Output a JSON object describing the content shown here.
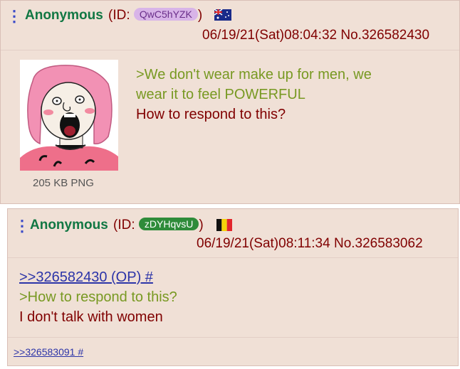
{
  "posts": [
    {
      "name": "Anonymous",
      "id_prefix": "(ID:",
      "id": "QwC5hYZK",
      "id_suffix": ")",
      "datetime": "06/19/21(Sat)08:04:32",
      "post_no": "No.326582430",
      "file_info": "205 KB PNG",
      "lines": [
        {
          "text": ">We don't wear make up for men, we",
          "style": "greentext"
        },
        {
          "text": "wear it to feel POWERFUL",
          "style": "greentext"
        },
        {
          "text": "How to respond to this?",
          "style": "normal"
        }
      ],
      "flag_icon": "australia-flag-icon",
      "id_badge_color": "#d8b4e8"
    },
    {
      "name": "Anonymous",
      "id_prefix": "(ID:",
      "id": "zDYHqvsU",
      "id_suffix": ")",
      "datetime": "06/19/21(Sat)08:11:34",
      "post_no": "No.326583062",
      "quotelink": ">>326582430 (OP) #",
      "lines": [
        {
          "text": ">How to respond to this?",
          "style": "greentext"
        },
        {
          "text": "I don't talk with women",
          "style": "normal"
        }
      ],
      "reply_link": ">>326583091 #",
      "flag_icon": "belgium-flag-icon",
      "id_badge_color": "#2e8b3a"
    }
  ]
}
